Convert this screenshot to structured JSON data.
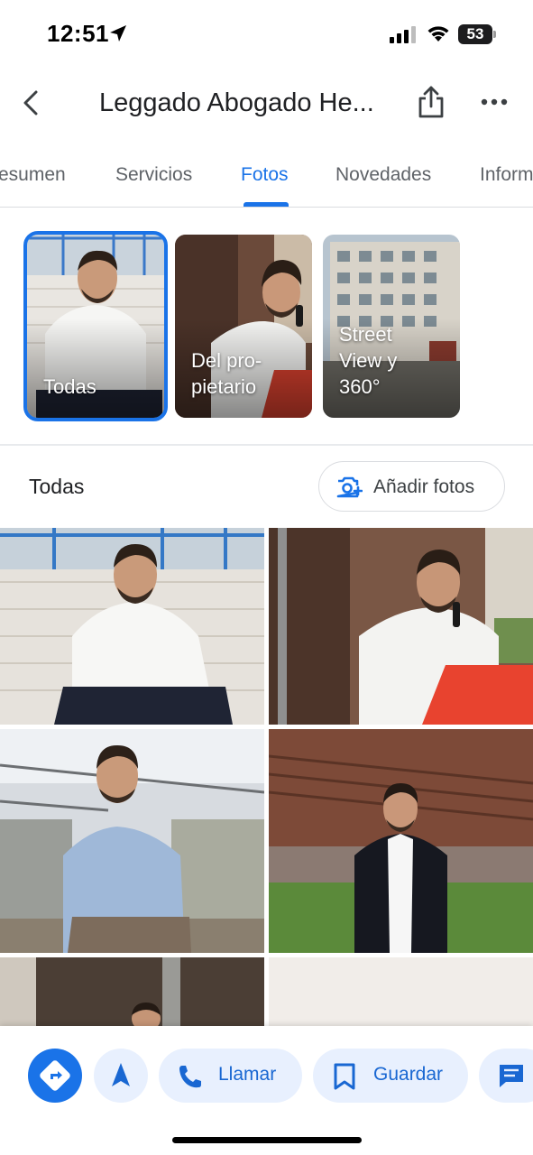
{
  "status_bar": {
    "time": "12:51",
    "battery": "53"
  },
  "header": {
    "title": "Leggado Abogado He..."
  },
  "tabs": [
    {
      "label": "esumen"
    },
    {
      "label": "Servicios"
    },
    {
      "label": "Fotos"
    },
    {
      "label": "Novedades"
    },
    {
      "label": "Inform"
    }
  ],
  "categories": [
    {
      "label": "Todas"
    },
    {
      "label": "Del pro-\npietario"
    },
    {
      "label": "Street\nView y\n360°"
    }
  ],
  "section": {
    "title": "Todas",
    "add_photos_label": "Añadir fotos"
  },
  "actions": {
    "call_label": "Llamar",
    "save_label": "Guardar"
  },
  "colors": {
    "accent": "#1a73e8",
    "pill_bg": "#e8f0fe",
    "pill_text": "#1967d2"
  }
}
